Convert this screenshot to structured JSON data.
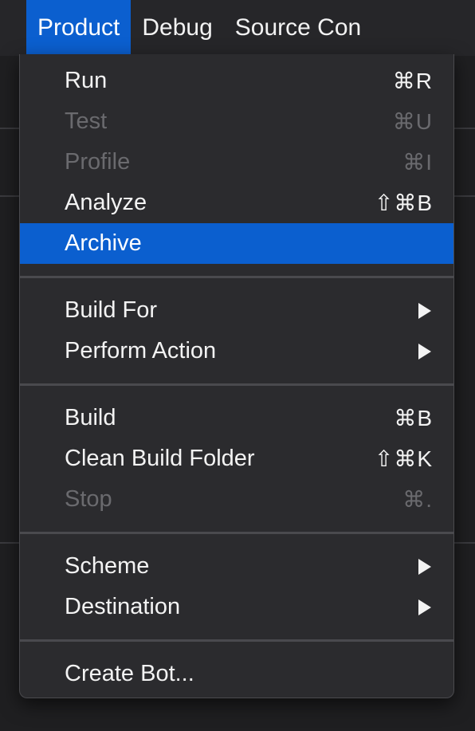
{
  "menubar": {
    "items": [
      {
        "label": "Product",
        "active": true
      },
      {
        "label": "Debug",
        "active": false
      },
      {
        "label": "Source Con",
        "active": false
      }
    ]
  },
  "menu": {
    "groups": [
      [
        {
          "label": "Run",
          "shortcut": "⌘R",
          "enabled": true,
          "highlighted": false,
          "submenu": false
        },
        {
          "label": "Test",
          "shortcut": "⌘U",
          "enabled": false,
          "highlighted": false,
          "submenu": false
        },
        {
          "label": "Profile",
          "shortcut": "⌘I",
          "enabled": false,
          "highlighted": false,
          "submenu": false
        },
        {
          "label": "Analyze",
          "shortcut": "⇧⌘B",
          "enabled": true,
          "highlighted": false,
          "submenu": false
        },
        {
          "label": "Archive",
          "shortcut": "",
          "enabled": true,
          "highlighted": true,
          "submenu": false
        }
      ],
      [
        {
          "label": "Build For",
          "shortcut": "",
          "enabled": true,
          "highlighted": false,
          "submenu": true
        },
        {
          "label": "Perform Action",
          "shortcut": "",
          "enabled": true,
          "highlighted": false,
          "submenu": true
        }
      ],
      [
        {
          "label": "Build",
          "shortcut": "⌘B",
          "enabled": true,
          "highlighted": false,
          "submenu": false
        },
        {
          "label": "Clean Build Folder",
          "shortcut": "⇧⌘K",
          "enabled": true,
          "highlighted": false,
          "submenu": false
        },
        {
          "label": "Stop",
          "shortcut": "⌘.",
          "enabled": false,
          "highlighted": false,
          "submenu": false
        }
      ],
      [
        {
          "label": "Scheme",
          "shortcut": "",
          "enabled": true,
          "highlighted": false,
          "submenu": true
        },
        {
          "label": "Destination",
          "shortcut": "",
          "enabled": true,
          "highlighted": false,
          "submenu": true
        }
      ],
      [
        {
          "label": "Create Bot...",
          "shortcut": "",
          "enabled": true,
          "highlighted": false,
          "submenu": false
        }
      ]
    ]
  },
  "colors": {
    "accent": "#0b5fcf",
    "menu_bg": "#2b2b2e",
    "text": "#f3f3f3",
    "disabled_text": "#6a6a6e"
  }
}
